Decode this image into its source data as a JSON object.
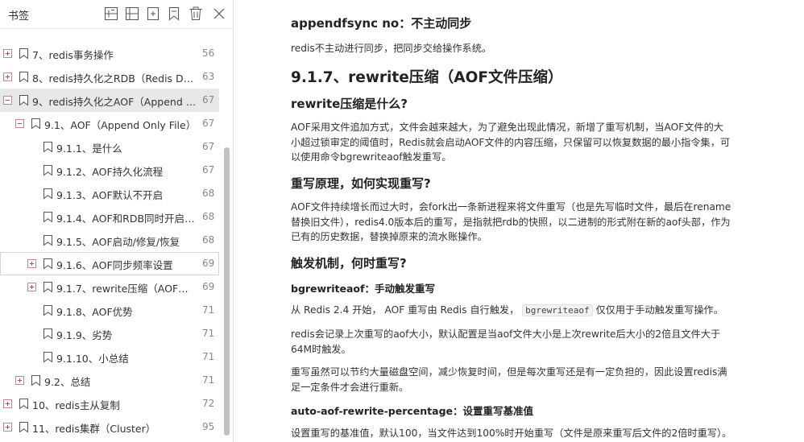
{
  "panel": {
    "title": "书签",
    "tools": [
      "expand-all-icon",
      "collapse-all-icon",
      "add-bookmark-icon",
      "bookmark-outline-icon",
      "delete-icon",
      "close-icon"
    ]
  },
  "bookmarks": [
    {
      "label": "7、redis事务操作",
      "page": "56",
      "expander": "plus"
    },
    {
      "label": "8、redis持久化之RDB（Redis Dat...",
      "page": "63",
      "expander": "plus"
    },
    {
      "label": "9、redis持久化之AOF（Append O...",
      "page": "67",
      "expander": "minus"
    },
    {
      "label": "9.1、AOF（Append Only File）",
      "page": "67",
      "expander": "minus"
    },
    {
      "label": "9.1.1、是什么",
      "page": "67",
      "expander": "none"
    },
    {
      "label": "9.1.2、AOF持久化流程",
      "page": "67",
      "expander": "none"
    },
    {
      "label": "9.1.3、AOF默认不开启",
      "page": "68",
      "expander": "none"
    },
    {
      "label": "9.1.4、AOF和RDB同时开启，...",
      "page": "68",
      "expander": "none"
    },
    {
      "label": "9.1.5、AOF启动/修复/恢复",
      "page": "68",
      "expander": "none"
    },
    {
      "label": "9.1.6、AOF同步频率设置",
      "page": "69",
      "expander": "plus"
    },
    {
      "label": "9.1.7、rewrite压缩（AOF文件...",
      "page": "69",
      "expander": "plus"
    },
    {
      "label": "9.1.8、AOF优势",
      "page": "71",
      "expander": "none"
    },
    {
      "label": "9.1.9、劣势",
      "page": "71",
      "expander": "none"
    },
    {
      "label": "9.1.10、小总结",
      "page": "71",
      "expander": "none"
    },
    {
      "label": "9.2、总结",
      "page": "71",
      "expander": "plus"
    },
    {
      "label": "10、redis主从复制",
      "page": "72",
      "expander": "plus"
    },
    {
      "label": "11、redis集群（Cluster）",
      "page": "95",
      "expander": "plus"
    }
  ],
  "doc": {
    "h_appendfsync": "appendfsync no：不主动同步",
    "p_appendfsync": "redis不主动进行同步，把同步交给操作系统。",
    "h_section": "9.1.7、rewrite压缩（AOF文件压缩）",
    "h_what": "rewrite压缩是什么?",
    "p_what": "AOF采用文件追加方式，文件会越来越大，为了避免出现此情况，新增了重写机制，当AOF文件的大小超过锁审定的阈值时，Redis就会启动AOF文件的内容压缩，只保留可以恢复数据的最小指令集，可以使用命令bgrewriteaof触发重写。",
    "h_principle": "重写原理，如何实现重写?",
    "p_principle": "AOF文件持续增长而过大时，会fork出一条新进程来将文件重写（也是先写临时文件，最后在rename替换旧文件），redis4.0版本后的重写，是指就把rdb的快照，以二进制的形式附在新的aof头部，作为已有的历史数据，替换掉原来的流水账操作。",
    "h_trigger": "触发机制，何时重写?",
    "h_bgrewrite": "bgrewriteaof：手动触发重写",
    "p_bgrewrite_pre": "从 Redis 2.4 开始， AOF 重写由 Redis 自行触发，",
    "p_bgrewrite_code": "bgrewriteaof",
    "p_bgrewrite_post": "仅仅用于手动触发重写操作。",
    "p_size": "redis会记录上次重写的aof大小，默认配置是当aof文件大小是上次rewrite后大小的2倍且文件大于64M时触发。",
    "p_cost": "重写虽然可以节约大量磁盘空间，减少恢复时间，但是每次重写还是有一定负担的，因此设置redis满足一定条件才会进行重新。",
    "h_percentage": "auto-aof-rewrite-percentage：设置重写基准值",
    "p_percentage": "设置重写的基准值，默认100，当文件达到100%时开始重写（文件是原来重写后文件的2倍时重写）。"
  }
}
